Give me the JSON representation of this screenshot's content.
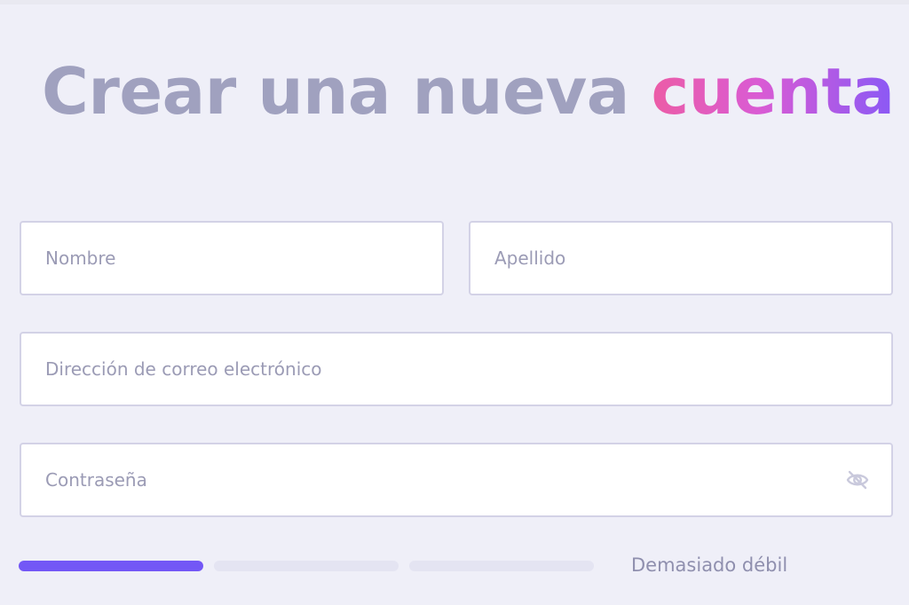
{
  "title": {
    "main": "Crear una nueva ",
    "accent": "cuenta"
  },
  "form": {
    "first_name": {
      "placeholder": "Nombre",
      "value": ""
    },
    "last_name": {
      "placeholder": "Apellido",
      "value": ""
    },
    "email": {
      "placeholder": "Dirección de correo electrónico",
      "value": ""
    },
    "password": {
      "placeholder": "Contraseña",
      "value": "",
      "toggle_icon": "eye-off-icon"
    }
  },
  "password_strength": {
    "level": 1,
    "max_level": 3,
    "label": "Demasiado débil"
  },
  "colors": {
    "background": "#efeff8",
    "title": "#a0a1bf",
    "accent_start": "#ec5ca6",
    "accent_end": "#8a59f5",
    "strength_active": "#7357f6",
    "strength_inactive": "#e4e4f2"
  }
}
